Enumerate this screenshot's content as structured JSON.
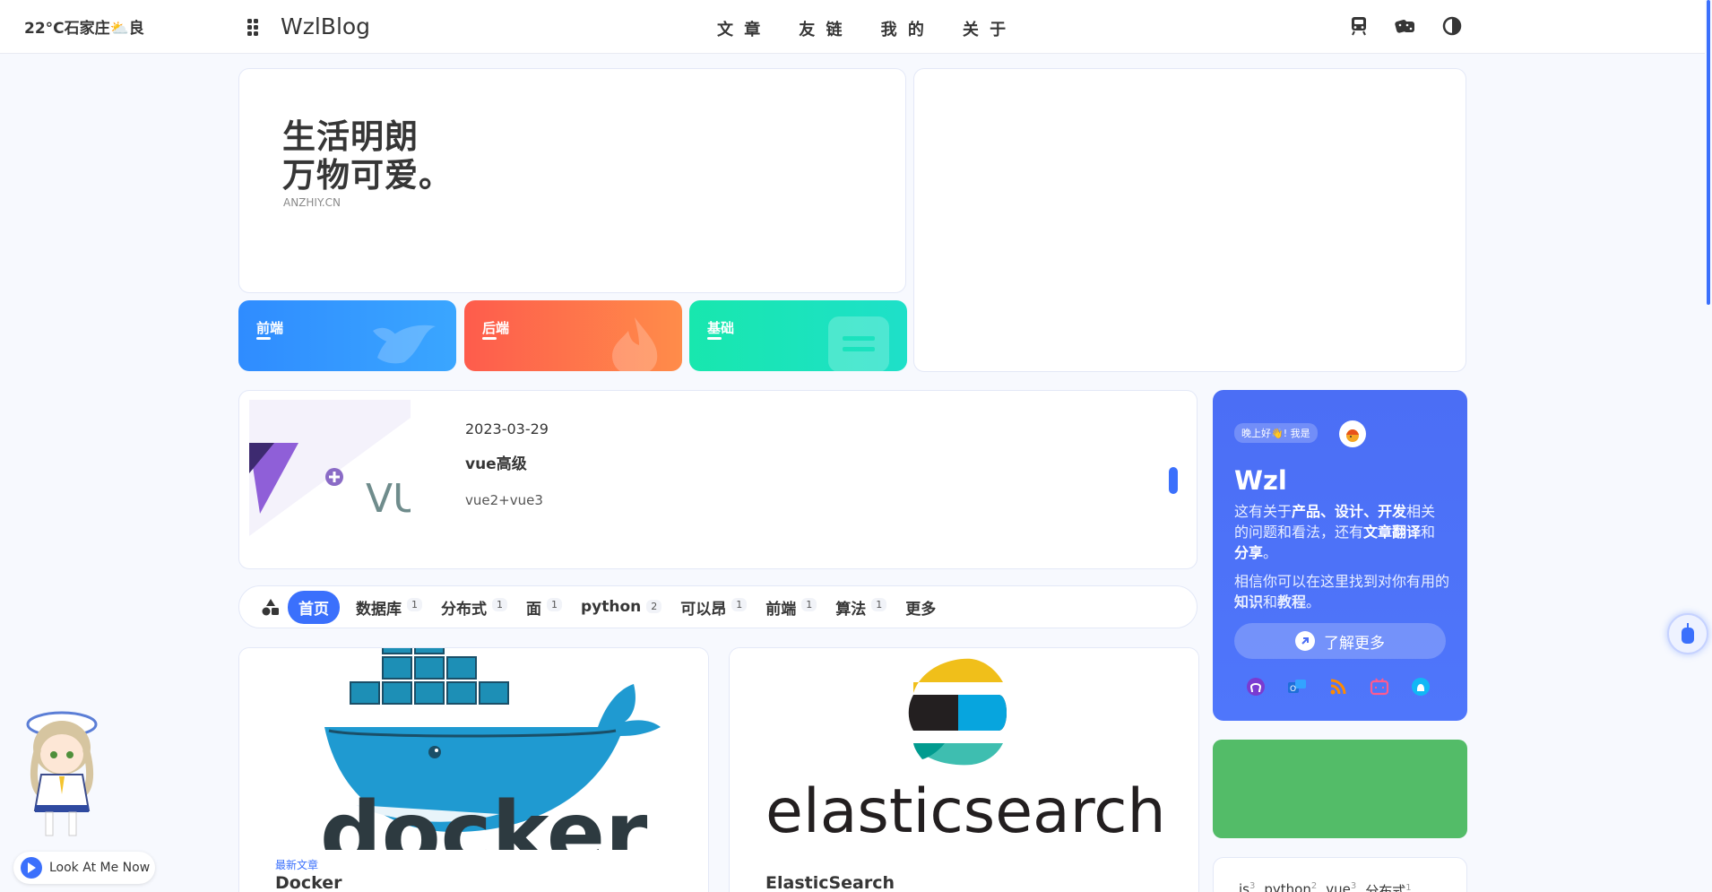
{
  "header": {
    "weather": "22°C石家庄⛅良",
    "site_title": "WzlBlog",
    "nav": [
      "文 章",
      "友 链",
      "我 的",
      "关 于"
    ],
    "right_icons": [
      "train-icon",
      "dice-icon",
      "contrast-icon"
    ]
  },
  "hero": {
    "slogan_line1": "生活明朗",
    "slogan_line2": "万物可爱。",
    "slogan_sub": "ANZHIY.CN",
    "tiles": [
      {
        "label": "前端",
        "color": "#2f8cff"
      },
      {
        "label": "后端",
        "color": "#fe5c4c"
      },
      {
        "label": "基础",
        "color": "#18e7ae"
      }
    ]
  },
  "featured": {
    "date": "2023-03-29",
    "title": "vue高级",
    "desc": "vue2+vue3",
    "thumb_text": "VU"
  },
  "categories": [
    {
      "name": "首页",
      "count": "",
      "active": true
    },
    {
      "name": "数据库",
      "count": "1"
    },
    {
      "name": "分布式",
      "count": "1"
    },
    {
      "name": "面",
      "count": "1"
    },
    {
      "name": "python",
      "count": "2"
    },
    {
      "name": "可以昂",
      "count": "1"
    },
    {
      "name": "前端",
      "count": "1"
    },
    {
      "name": "算法",
      "count": "1"
    },
    {
      "name": "更多",
      "count": ""
    }
  ],
  "posts": [
    {
      "tag": "最新文章",
      "title": "Docker",
      "cover_text": "docker"
    },
    {
      "tag": "",
      "title": "ElasticSearch",
      "cover_text": "elasticsearch"
    }
  ],
  "author": {
    "greeting": "晚上好👋! 我是",
    "name": "Wzl",
    "desc_1": "这有关于",
    "desc_b1": "产品",
    "desc_s1": "、",
    "desc_b2": "设计",
    "desc_s2": "、",
    "desc_b3": "开发",
    "desc_2": "相关的问题和看法，还有",
    "desc_b4": "文章翻译",
    "desc_3": "和",
    "desc_b5": "分享",
    "desc_4": "。",
    "desc2_1": "相信你可以在这里找到对你有用的",
    "desc2_b1": "知识",
    "desc2_2": "和",
    "desc2_b2": "教程",
    "desc2_3": "。",
    "button": "了解更多",
    "socials": [
      "github-icon",
      "email-icon",
      "rss-icon",
      "bilibili-icon",
      "qq-icon"
    ]
  },
  "tags": [
    {
      "name": "js",
      "count": "3"
    },
    {
      "name": "python",
      "count": "2"
    },
    {
      "name": "vue",
      "count": "3"
    },
    {
      "name": "分布式",
      "count": "1"
    }
  ],
  "music": {
    "title": "Look At Me Now"
  },
  "colors": {
    "accent": "#3b70fc",
    "green": "#53bc68"
  }
}
